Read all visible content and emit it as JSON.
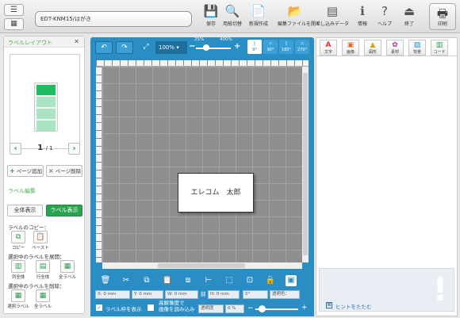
{
  "toolbar": {
    "title": "EDT-KNM15/はがき",
    "buttons": [
      {
        "label": "保存",
        "icon": "save-icon",
        "glyph": "💾"
      },
      {
        "label": "用紙切替",
        "icon": "paper-switch-icon",
        "glyph": "🔍"
      },
      {
        "label": "新規作成",
        "icon": "new-doc-icon",
        "glyph": "📄"
      },
      {
        "label": "編集ファイルを開く",
        "icon": "open-file-icon",
        "glyph": "📂"
      },
      {
        "label": "差し込みデータ",
        "icon": "merge-data-icon",
        "glyph": "▤"
      },
      {
        "label": "情報",
        "icon": "info-icon",
        "glyph": "ℹ"
      },
      {
        "label": "ヘルプ",
        "icon": "help-icon",
        "glyph": "?"
      },
      {
        "label": "終了",
        "icon": "exit-icon",
        "glyph": "⏏"
      }
    ],
    "print_label": "印刷"
  },
  "left_panel": {
    "title": "ラベルレイアウト",
    "page_current": "1",
    "page_total": "/ 1",
    "add_page": "ページ追加",
    "delete_page": "ページ削除",
    "edit_section": "ラベル編集",
    "view_all": "全体表示",
    "view_label": "ラベル表示",
    "copy_section": "ラベルのコピー：",
    "copy": "コピー",
    "paste": "ペースト",
    "expand_section": "選択中のラベルを展開：",
    "expand_col": "列全体",
    "expand_row": "行全体",
    "expand_all": "全ラベル",
    "delete_section": "選択中のラベルを削除：",
    "delete_selected": "選択ラベル",
    "delete_all": "全ラベル"
  },
  "canvas": {
    "zoom_value": "100%",
    "zoom_min": "25%",
    "zoom_max": "400%",
    "zoom_level": 0.25,
    "rotations": [
      "0°",
      "90°",
      "180°",
      "270°"
    ],
    "label_text": "エレコム　太郎"
  },
  "bottom": {
    "x_label": "X:",
    "x_value": "0 mm",
    "y_label": "Y:",
    "y_value": "0 mm",
    "w_label": "W:",
    "w_value": "0 mm",
    "h_label": "H:",
    "h_value": "0 mm",
    "rotate_value": "0°",
    "transparent_color": "透明色：",
    "show_frame": "ラベル枠を表示",
    "hi_res_line1": "高解像度で",
    "hi_res_line2": "画像を読み込み",
    "opacity_label": "透明度",
    "opacity_value": "0 %"
  },
  "right_panel": {
    "tabs": [
      {
        "label": "文字",
        "glyph": "A",
        "color": "#d9332b"
      },
      {
        "label": "画像",
        "glyph": "▣",
        "color": "#e06a2c"
      },
      {
        "label": "図形",
        "glyph": "▲",
        "color": "#d8a419"
      },
      {
        "label": "素材",
        "glyph": "✿",
        "color": "#b23a8a"
      },
      {
        "label": "背景",
        "glyph": "▨",
        "color": "#2a8dc4"
      },
      {
        "label": "コード",
        "glyph": "▥",
        "color": "#2e9b50"
      }
    ],
    "hint_label": "ヒントをたたむ"
  },
  "colors": {
    "accent": "#2a8dc4",
    "green": "#2aa34f"
  }
}
